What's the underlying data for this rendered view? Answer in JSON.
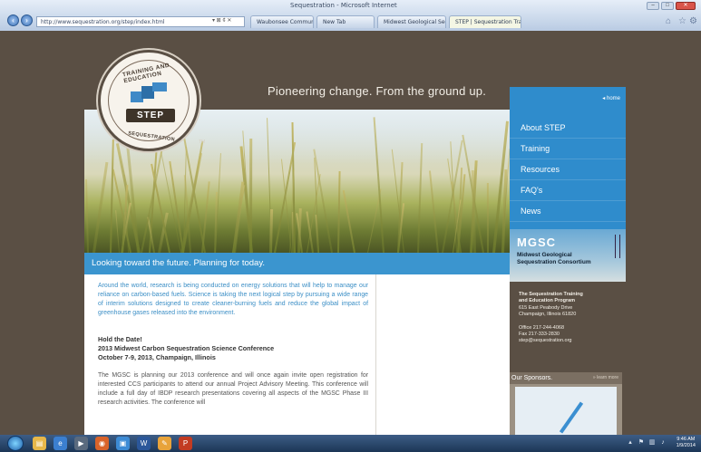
{
  "browser": {
    "window_title": "Sequestration - Microsoft Internet",
    "address": "http://www.sequestration.org/step/index.html",
    "tabs": [
      {
        "label": "Waubonsee Community Colle..."
      },
      {
        "label": "New Tab"
      },
      {
        "label": "Midwest Geological Sequestrati..."
      },
      {
        "label": "STEP | Sequestration Trainin..."
      }
    ]
  },
  "header": {
    "tagline": "Pioneering change. From the ground up.",
    "logo": {
      "top_text": "TRAINING AND EDUCATION",
      "bottom_text": "SEQUESTRATION",
      "name": "STEP",
      "tm": "TM"
    }
  },
  "sidebar": {
    "home_link": "home",
    "nav": [
      {
        "label": "About STEP"
      },
      {
        "label": "Training"
      },
      {
        "label": "Resources"
      },
      {
        "label": "FAQ's"
      },
      {
        "label": "News"
      }
    ],
    "mgsc": {
      "title": "MGSC",
      "subtitle_1": "Midwest Geological",
      "subtitle_2": "Sequestration Consortium"
    },
    "address": {
      "line1": "The Sequestration Training",
      "line2": "and Education Program",
      "line3": "615 East Peabody Drive",
      "line4": "Champaign, Illinois 61820",
      "office": "Office 217-244-4068",
      "fax": "Fax 217-333-2830",
      "email": "step@sequestration.org"
    },
    "sponsors": {
      "title": "Our Sponsors.",
      "learn_more": "» learn more"
    }
  },
  "main": {
    "banner": "Looking toward the future. Planning for today.",
    "intro": "Around the world, research is being conducted on energy solutions that will help to manage our reliance on carbon-based fuels. Science is taking the next logical step by pursuing a wide range of interim solutions designed to create cleaner-burning fuels and reduce the global impact of greenhouse gases released into the environment.",
    "hold_date": "Hold the Date!",
    "conference_title": "2013 Midwest Carbon Sequestration Science Conference",
    "conference_date": "October 7-9, 2013, Champaign, Illinois",
    "body": "The MGSC is planning our 2013 conference and will once again invite open registration for interested CCS participants to attend our annual Project Advisory Meeting. This conference will include a full day of IBDP research presentations covering all aspects of the MGSC Phase III research activities. The conference will"
  },
  "taskbar": {
    "time": "9:46 AM",
    "date": "1/9/2014"
  },
  "colors": {
    "page_bg": "#5a4f44",
    "accent_blue": "#3b95cf",
    "sidebar_blue": "#2f8ccc",
    "intro_text": "#3c8fc6"
  }
}
